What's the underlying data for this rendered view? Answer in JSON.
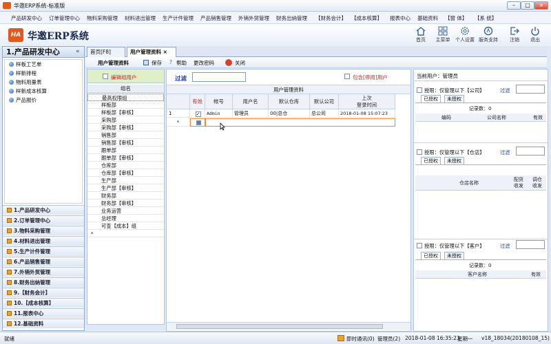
{
  "window": {
    "title": "华邀ERP系统-标准版"
  },
  "menu": [
    "产品研发中心",
    "订单管理中心",
    "物料采购管理",
    "材料进出管理",
    "生产计件管理",
    "产品销售管理",
    "外销外贸管理",
    "财务出纳管理",
    "【财务会计】",
    "【成本核算】",
    "报表中心",
    "基础资料",
    "【窗 体】",
    "【系 统】"
  ],
  "brand": {
    "name": "华邀ERP系统",
    "logo_text": "HA"
  },
  "toolbar": [
    {
      "label": "首页",
      "icon": "home-icon"
    },
    {
      "label": "主菜单",
      "icon": "grid-icon"
    },
    {
      "label": "个人设置",
      "icon": "gear-icon"
    },
    {
      "label": "服务支持",
      "icon": "support-icon"
    },
    {
      "label": "注销",
      "icon": "logout-icon"
    },
    {
      "label": "退出",
      "icon": "power-icon"
    }
  ],
  "left": {
    "title": "1.产品研发中心",
    "collapse": "«",
    "items": [
      "样板工艺单",
      "样新排程",
      "物料用量表",
      "样新成本核算",
      "产品报价"
    ],
    "nav": [
      "1.产品研发中心",
      "2.订单管理中心",
      "3.物料采购管理",
      "4.材料进出管理",
      "5.生产计件管理",
      "6.产品销售管理",
      "7.外销外贸管理",
      "8.财务出纳管理",
      "9.【财务会计】",
      "10.【成本核算】",
      "11.报表中心",
      "12.基础资料"
    ]
  },
  "tabs": [
    {
      "label": "首页[F8]"
    },
    {
      "label": "用户管理资料",
      "close": "×"
    }
  ],
  "subtoolbar": {
    "title": "用户管理资料",
    "save": "保存",
    "help": "帮助",
    "change_pwd": "更改密码",
    "close": "关闭"
  },
  "groups": {
    "edit_label": "编辑组用户",
    "col": "组名",
    "rows": [
      "最高权限组",
      "样板部",
      "样板部【审核】",
      "采购部",
      "采购部【审核】",
      "销售部",
      "销售部【审核】",
      "跟单部",
      "跟单部【审核】",
      "仓库部",
      "仓库部【审核】",
      "生产部",
      "生产部【审核】",
      "财务部",
      "财务部【审核】",
      "业务运营",
      "总经理",
      "可查【成本】组"
    ],
    "new_marker": "*"
  },
  "users": {
    "filter_label": "过滤",
    "filter_value": "",
    "include_disabled": "包含[停用]用户",
    "caption": "用户管理资料",
    "cols": [
      "有效",
      "帐号",
      "用户名",
      "默认仓库",
      "默认公司",
      "上次\n登录时间"
    ],
    "rows": [
      {
        "idx": "1",
        "valid": true,
        "account": "Admin",
        "name": "管理员",
        "warehouse": "00|总仓",
        "company": "总公司",
        "last_login": "2018-01-08 15:07:23"
      }
    ],
    "new_marker": "*"
  },
  "right": {
    "current_user_label": "当前用户：",
    "current_user": "管理员",
    "sections": [
      {
        "title": "授限：仅管理以下【公司】",
        "filter": "过滤",
        "tabs": [
          "已授权",
          "未授权"
        ],
        "count": "记录数：0",
        "cols": [
          "编码",
          "公司名称",
          "有效"
        ]
      },
      {
        "title": "授限：仅管理以下【仓店】",
        "filter": "过滤",
        "tabs": [
          "已授权",
          "未授权"
        ],
        "count": "",
        "cols": [
          "仓店名称",
          "配货\n收发",
          "调仓\n收发"
        ]
      },
      {
        "title": "授限：仅管理以下【客户】",
        "filter": "过滤",
        "tabs": [
          "已授权",
          "未授权"
        ],
        "count": "记录数：0",
        "cols": [
          "客户名称",
          "有效"
        ]
      }
    ]
  },
  "status": {
    "left": "就绪",
    "msg": "即时通讯(0)",
    "user": "管理员(2)",
    "datetime": "2018-01-08  16:35:23",
    "weekday": "星期一",
    "version": "v18_18034(20180108_15)"
  }
}
